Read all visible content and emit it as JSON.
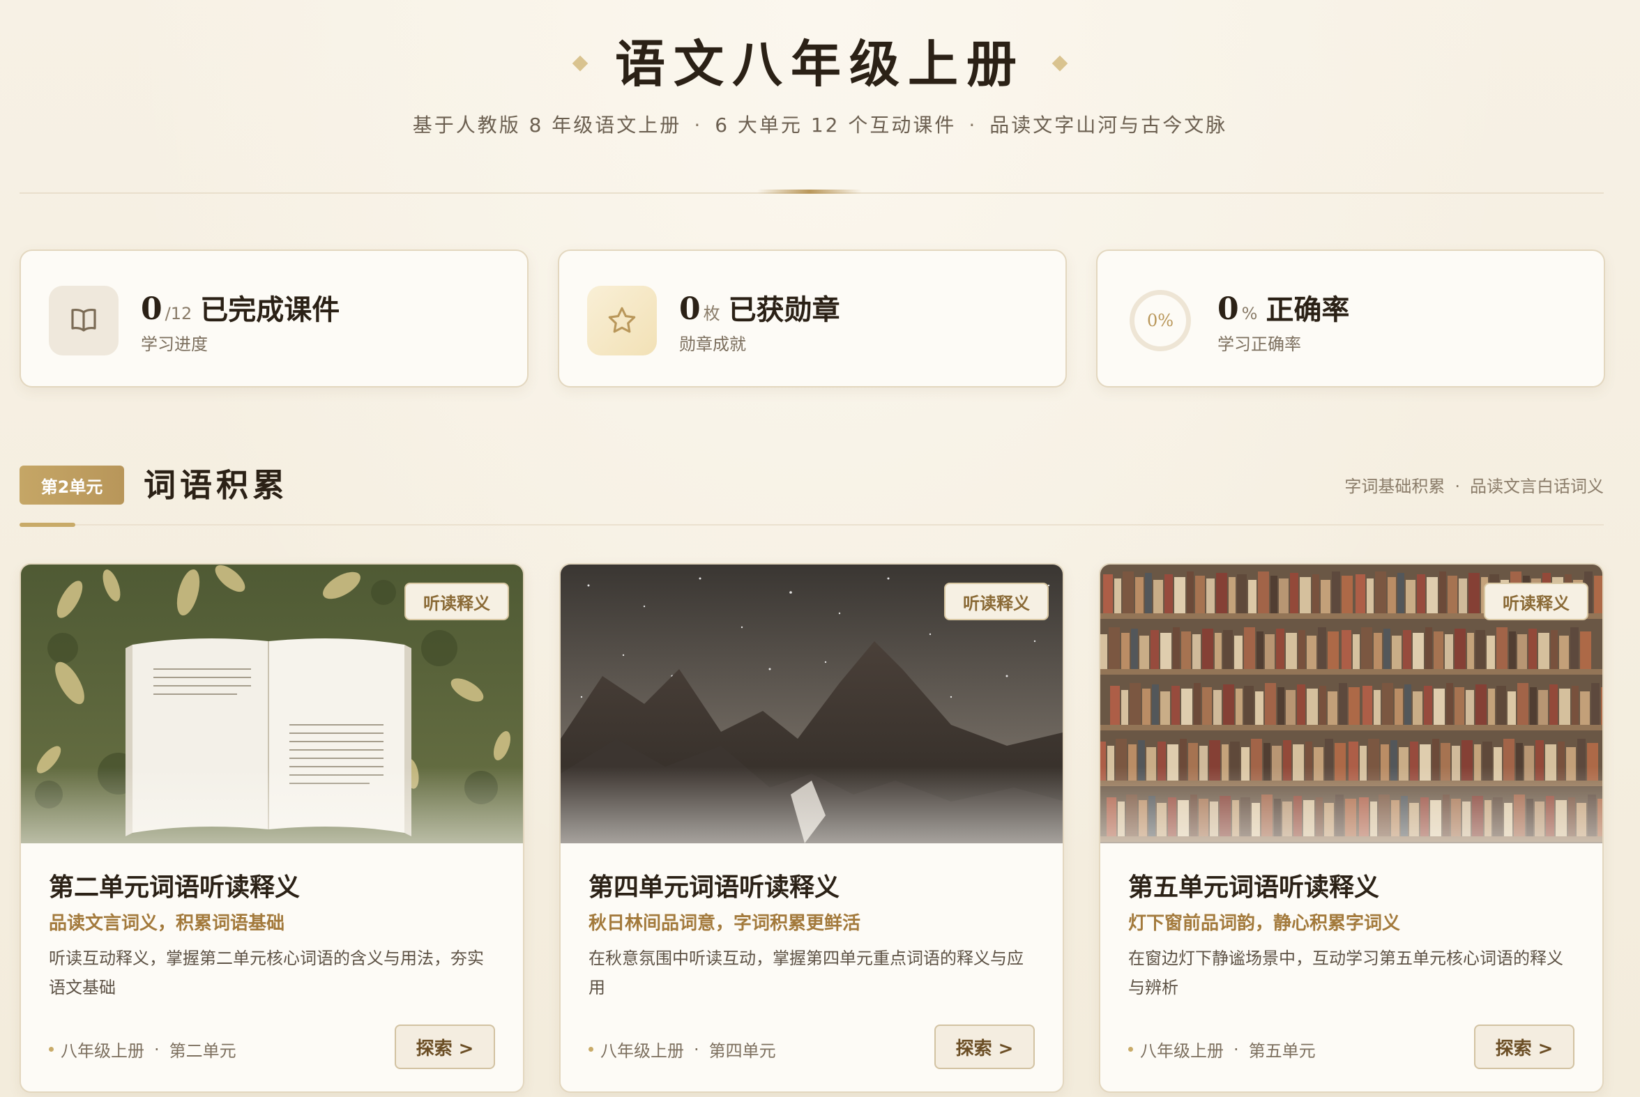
{
  "header": {
    "title": "语文八年级上册",
    "subtitle_parts": [
      "基于人教版 8 年级语文上册",
      "6 大单元 12 个互动课件",
      "品读文字山河与古今文脉"
    ],
    "separator": "·"
  },
  "stats": [
    {
      "icon": "book-icon",
      "value": "0",
      "unit": "/12",
      "label": "已完成课件",
      "sub": "学习进度"
    },
    {
      "icon": "star-icon",
      "value": "0",
      "unit": "枚",
      "label": "已获勋章",
      "sub": "勋章成就"
    },
    {
      "icon": "progress-ring",
      "ring_text": "0%",
      "ring_value": 0,
      "value": "0",
      "unit": "%",
      "label": "正确率",
      "sub": "学习正确率"
    }
  ],
  "unit": {
    "badge": "第2单元",
    "title": "词语积累",
    "tags": [
      "字词基础积累",
      "品读文言白话词义"
    ],
    "separator": "·"
  },
  "cards": [
    {
      "badge": "听读释义",
      "title": "第二单元词语听读释义",
      "subtitle": "品读文言词义，积累词语基础",
      "description": "听读互动释义，掌握第二单元核心词语的含义与用法，夯实语文基础",
      "meta": [
        "八年级上册",
        "第二单元"
      ],
      "button": "探索 >"
    },
    {
      "badge": "听读释义",
      "title": "第四单元词语听读释义",
      "subtitle": "秋日林间品词意，字词积累更鲜活",
      "description": "在秋意氛围中听读互动，掌握第四单元重点词语的释义与应用",
      "meta": [
        "八年级上册",
        "第四单元"
      ],
      "button": "探索 >"
    },
    {
      "badge": "听读释义",
      "title": "第五单元词语听读释义",
      "subtitle": "灯下窗前品词韵，静心积累字词义",
      "description": "在窗边灯下静谧场景中，互动学习第五单元核心词语的释义与辨析",
      "meta": [
        "八年级上册",
        "第五单元"
      ],
      "button": "探索 >"
    }
  ],
  "colors": {
    "accent": "#b9975a",
    "background": "#f6f0e3",
    "card": "#fdfbf6"
  }
}
